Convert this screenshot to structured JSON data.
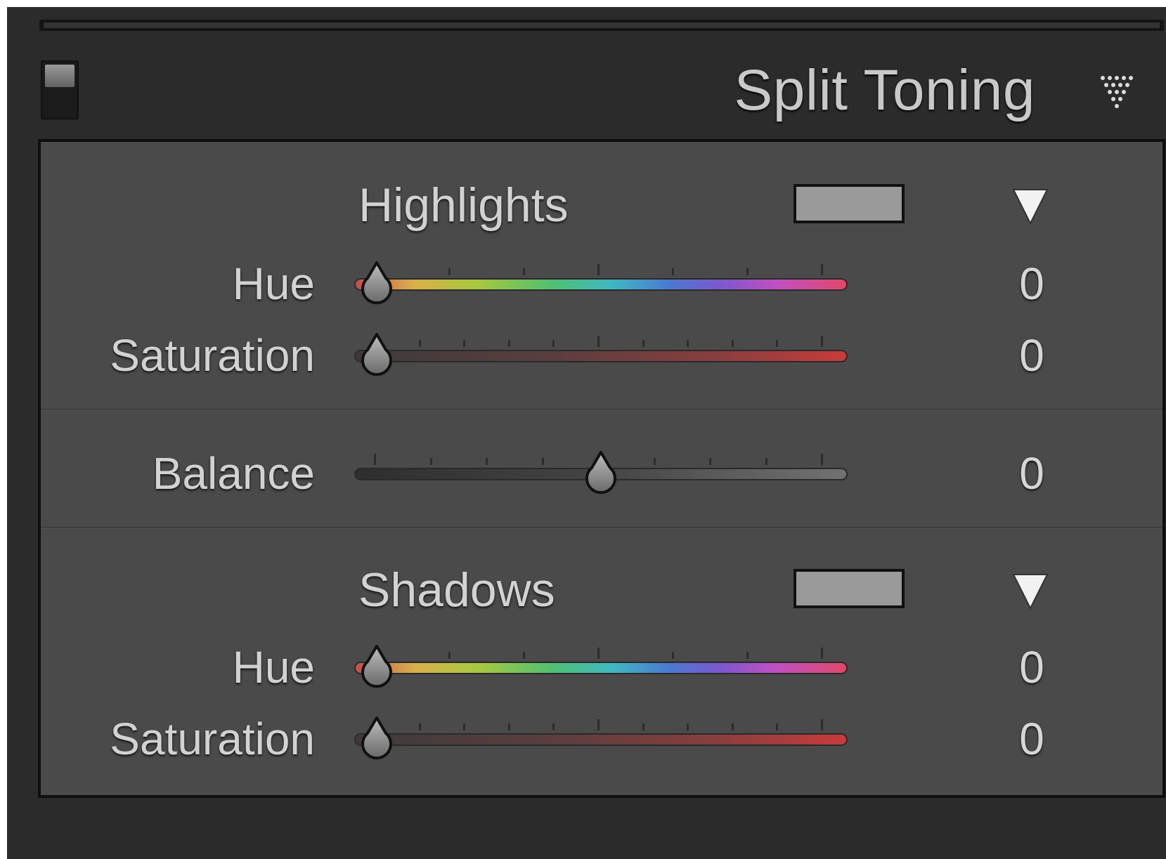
{
  "panel": {
    "title": "Split Toning"
  },
  "highlights": {
    "heading": "Highlights",
    "swatch_color": "#9a9a9a",
    "hue": {
      "label": "Hue",
      "value": "0",
      "level": 0
    },
    "saturation": {
      "label": "Saturation",
      "value": "0",
      "level": 0
    }
  },
  "balance": {
    "label": "Balance",
    "value": "0",
    "level": 0.5
  },
  "shadows": {
    "heading": "Shadows",
    "swatch_color": "#9a9a9a",
    "hue": {
      "label": "Hue",
      "value": "0",
      "level": 0
    },
    "saturation": {
      "label": "Saturation",
      "value": "0",
      "level": 0
    }
  },
  "icons": {
    "panel_menu": "panel-menu-icon",
    "disclosure": "disclosure-triangle-icon",
    "thumb": "slider-thumb-icon"
  },
  "colors": {
    "panel_bg": "#2b2b2b",
    "section_bg": "#4a4a4a",
    "text": "#d2d2d2"
  }
}
